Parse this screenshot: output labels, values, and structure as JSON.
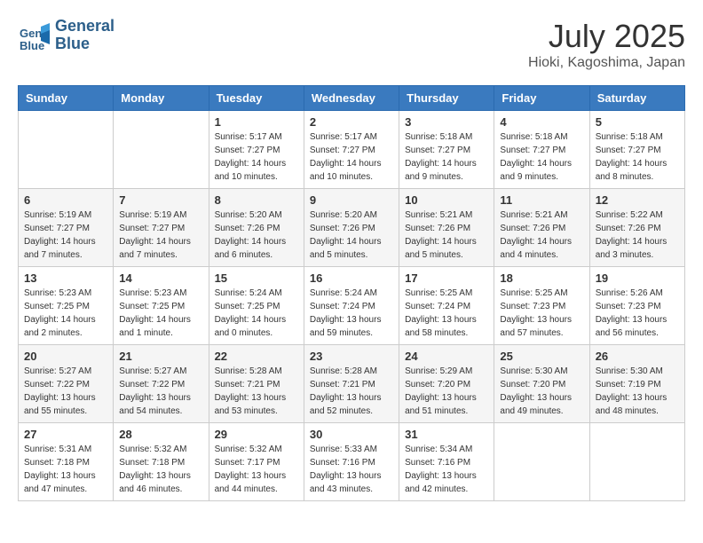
{
  "header": {
    "logo_line1": "General",
    "logo_line2": "Blue",
    "month": "July 2025",
    "location": "Hioki, Kagoshima, Japan"
  },
  "weekdays": [
    "Sunday",
    "Monday",
    "Tuesday",
    "Wednesday",
    "Thursday",
    "Friday",
    "Saturday"
  ],
  "weeks": [
    [
      {
        "day": "",
        "info": ""
      },
      {
        "day": "",
        "info": ""
      },
      {
        "day": "1",
        "info": "Sunrise: 5:17 AM\nSunset: 7:27 PM\nDaylight: 14 hours\nand 10 minutes."
      },
      {
        "day": "2",
        "info": "Sunrise: 5:17 AM\nSunset: 7:27 PM\nDaylight: 14 hours\nand 10 minutes."
      },
      {
        "day": "3",
        "info": "Sunrise: 5:18 AM\nSunset: 7:27 PM\nDaylight: 14 hours\nand 9 minutes."
      },
      {
        "day": "4",
        "info": "Sunrise: 5:18 AM\nSunset: 7:27 PM\nDaylight: 14 hours\nand 9 minutes."
      },
      {
        "day": "5",
        "info": "Sunrise: 5:18 AM\nSunset: 7:27 PM\nDaylight: 14 hours\nand 8 minutes."
      }
    ],
    [
      {
        "day": "6",
        "info": "Sunrise: 5:19 AM\nSunset: 7:27 PM\nDaylight: 14 hours\nand 7 minutes."
      },
      {
        "day": "7",
        "info": "Sunrise: 5:19 AM\nSunset: 7:27 PM\nDaylight: 14 hours\nand 7 minutes."
      },
      {
        "day": "8",
        "info": "Sunrise: 5:20 AM\nSunset: 7:26 PM\nDaylight: 14 hours\nand 6 minutes."
      },
      {
        "day": "9",
        "info": "Sunrise: 5:20 AM\nSunset: 7:26 PM\nDaylight: 14 hours\nand 5 minutes."
      },
      {
        "day": "10",
        "info": "Sunrise: 5:21 AM\nSunset: 7:26 PM\nDaylight: 14 hours\nand 5 minutes."
      },
      {
        "day": "11",
        "info": "Sunrise: 5:21 AM\nSunset: 7:26 PM\nDaylight: 14 hours\nand 4 minutes."
      },
      {
        "day": "12",
        "info": "Sunrise: 5:22 AM\nSunset: 7:26 PM\nDaylight: 14 hours\nand 3 minutes."
      }
    ],
    [
      {
        "day": "13",
        "info": "Sunrise: 5:23 AM\nSunset: 7:25 PM\nDaylight: 14 hours\nand 2 minutes."
      },
      {
        "day": "14",
        "info": "Sunrise: 5:23 AM\nSunset: 7:25 PM\nDaylight: 14 hours\nand 1 minute."
      },
      {
        "day": "15",
        "info": "Sunrise: 5:24 AM\nSunset: 7:25 PM\nDaylight: 14 hours\nand 0 minutes."
      },
      {
        "day": "16",
        "info": "Sunrise: 5:24 AM\nSunset: 7:24 PM\nDaylight: 13 hours\nand 59 minutes."
      },
      {
        "day": "17",
        "info": "Sunrise: 5:25 AM\nSunset: 7:24 PM\nDaylight: 13 hours\nand 58 minutes."
      },
      {
        "day": "18",
        "info": "Sunrise: 5:25 AM\nSunset: 7:23 PM\nDaylight: 13 hours\nand 57 minutes."
      },
      {
        "day": "19",
        "info": "Sunrise: 5:26 AM\nSunset: 7:23 PM\nDaylight: 13 hours\nand 56 minutes."
      }
    ],
    [
      {
        "day": "20",
        "info": "Sunrise: 5:27 AM\nSunset: 7:22 PM\nDaylight: 13 hours\nand 55 minutes."
      },
      {
        "day": "21",
        "info": "Sunrise: 5:27 AM\nSunset: 7:22 PM\nDaylight: 13 hours\nand 54 minutes."
      },
      {
        "day": "22",
        "info": "Sunrise: 5:28 AM\nSunset: 7:21 PM\nDaylight: 13 hours\nand 53 minutes."
      },
      {
        "day": "23",
        "info": "Sunrise: 5:28 AM\nSunset: 7:21 PM\nDaylight: 13 hours\nand 52 minutes."
      },
      {
        "day": "24",
        "info": "Sunrise: 5:29 AM\nSunset: 7:20 PM\nDaylight: 13 hours\nand 51 minutes."
      },
      {
        "day": "25",
        "info": "Sunrise: 5:30 AM\nSunset: 7:20 PM\nDaylight: 13 hours\nand 49 minutes."
      },
      {
        "day": "26",
        "info": "Sunrise: 5:30 AM\nSunset: 7:19 PM\nDaylight: 13 hours\nand 48 minutes."
      }
    ],
    [
      {
        "day": "27",
        "info": "Sunrise: 5:31 AM\nSunset: 7:18 PM\nDaylight: 13 hours\nand 47 minutes."
      },
      {
        "day": "28",
        "info": "Sunrise: 5:32 AM\nSunset: 7:18 PM\nDaylight: 13 hours\nand 46 minutes."
      },
      {
        "day": "29",
        "info": "Sunrise: 5:32 AM\nSunset: 7:17 PM\nDaylight: 13 hours\nand 44 minutes."
      },
      {
        "day": "30",
        "info": "Sunrise: 5:33 AM\nSunset: 7:16 PM\nDaylight: 13 hours\nand 43 minutes."
      },
      {
        "day": "31",
        "info": "Sunrise: 5:34 AM\nSunset: 7:16 PM\nDaylight: 13 hours\nand 42 minutes."
      },
      {
        "day": "",
        "info": ""
      },
      {
        "day": "",
        "info": ""
      }
    ]
  ]
}
